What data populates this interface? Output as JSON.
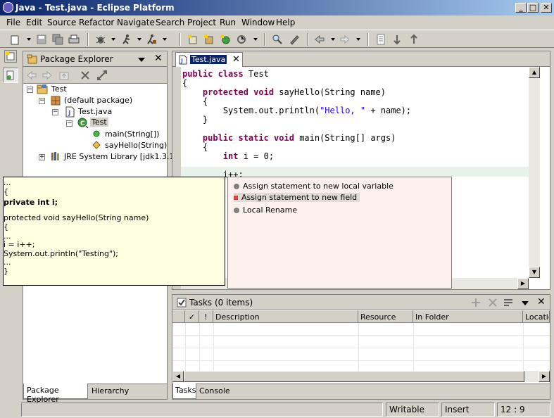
{
  "window": {
    "title": "Java - Test.java - Eclipse Platform",
    "min": "_",
    "max": "□",
    "close": "✕"
  },
  "menu": [
    "File",
    "Edit",
    "Source",
    "Refactor",
    "Navigate",
    "Search",
    "Project",
    "Run",
    "Window",
    "Help"
  ],
  "package_explorer": {
    "title": "Package Explorer",
    "tree": [
      {
        "label": "Test"
      },
      {
        "label": "(default package)"
      },
      {
        "label": "Test.java"
      },
      {
        "label": "Test"
      },
      {
        "label": "main(String[])"
      },
      {
        "label": "sayHello(String)"
      },
      {
        "label": "JRE System Library [jdk1.3.1]"
      }
    ],
    "tabs": [
      "Package Explorer",
      "Hierarchy"
    ]
  },
  "editor": {
    "tab": "Test.java",
    "lines": [
      {
        "parts": [
          [
            "kw",
            "public class "
          ],
          [
            "t",
            "Test"
          ]
        ]
      },
      {
        "parts": [
          [
            "t",
            "{"
          ]
        ]
      },
      {
        "parts": [
          [
            "t",
            "    "
          ],
          [
            "kw",
            "protected void "
          ],
          [
            "t",
            "sayHello(String name)"
          ]
        ]
      },
      {
        "parts": [
          [
            "t",
            "    {"
          ]
        ]
      },
      {
        "parts": [
          [
            "t",
            "        System.out.println("
          ],
          [
            "str",
            "\"Hello, \""
          ],
          [
            "t",
            " + name);"
          ]
        ]
      },
      {
        "parts": [
          [
            "t",
            "    }"
          ]
        ]
      },
      {
        "parts": [
          [
            "t",
            ""
          ]
        ]
      },
      {
        "parts": [
          [
            "t",
            "    "
          ],
          [
            "kw",
            "public static void "
          ],
          [
            "t",
            "main(String[] args)"
          ]
        ]
      },
      {
        "parts": [
          [
            "t",
            "    {"
          ]
        ]
      },
      {
        "parts": [
          [
            "t",
            "        "
          ],
          [
            "kw",
            "int "
          ],
          [
            "t",
            "i = 0;"
          ]
        ]
      },
      {
        "parts": [
          [
            "t",
            ""
          ]
        ]
      },
      {
        "parts": [
          [
            "t",
            "        i++;"
          ]
        ]
      }
    ]
  },
  "quick_fix": {
    "items": [
      "Assign statement to new local variable",
      "Assign statement to new field",
      "Local Rename"
    ]
  },
  "preview": {
    "lines": [
      {
        "text": "...",
        "bold": false
      },
      {
        "text": "{",
        "bold": false
      },
      {
        "text": "private int i;",
        "bold": true
      },
      {
        "text": "",
        "bold": false
      },
      {
        "text": "protected void sayHello(String name)",
        "bold": false
      },
      {
        "text": "{",
        "bold": false
      },
      {
        "text": "...",
        "bold": false
      },
      {
        "text": "i = i++;",
        "bold": false
      },
      {
        "text": "System.out.println(\"Testing\");",
        "bold": false
      },
      {
        "text": "...",
        "bold": false
      },
      {
        "text": "}",
        "bold": false
      }
    ]
  },
  "tasks": {
    "title": "Tasks (0 items)",
    "columns": [
      "✓",
      "!",
      "Description",
      "Resource",
      "In Folder",
      "Locatio"
    ],
    "tabs": [
      "Tasks",
      "Console"
    ]
  },
  "status": {
    "writable": "Writable",
    "insert": "Insert",
    "position": "12 : 9"
  },
  "colors": {
    "titlebar": "#0a246a",
    "keyword": "#7f0055",
    "string": "#2a00ff",
    "tooltip": "#ffffe1",
    "quickfix_bg": "#fdf1ed"
  }
}
